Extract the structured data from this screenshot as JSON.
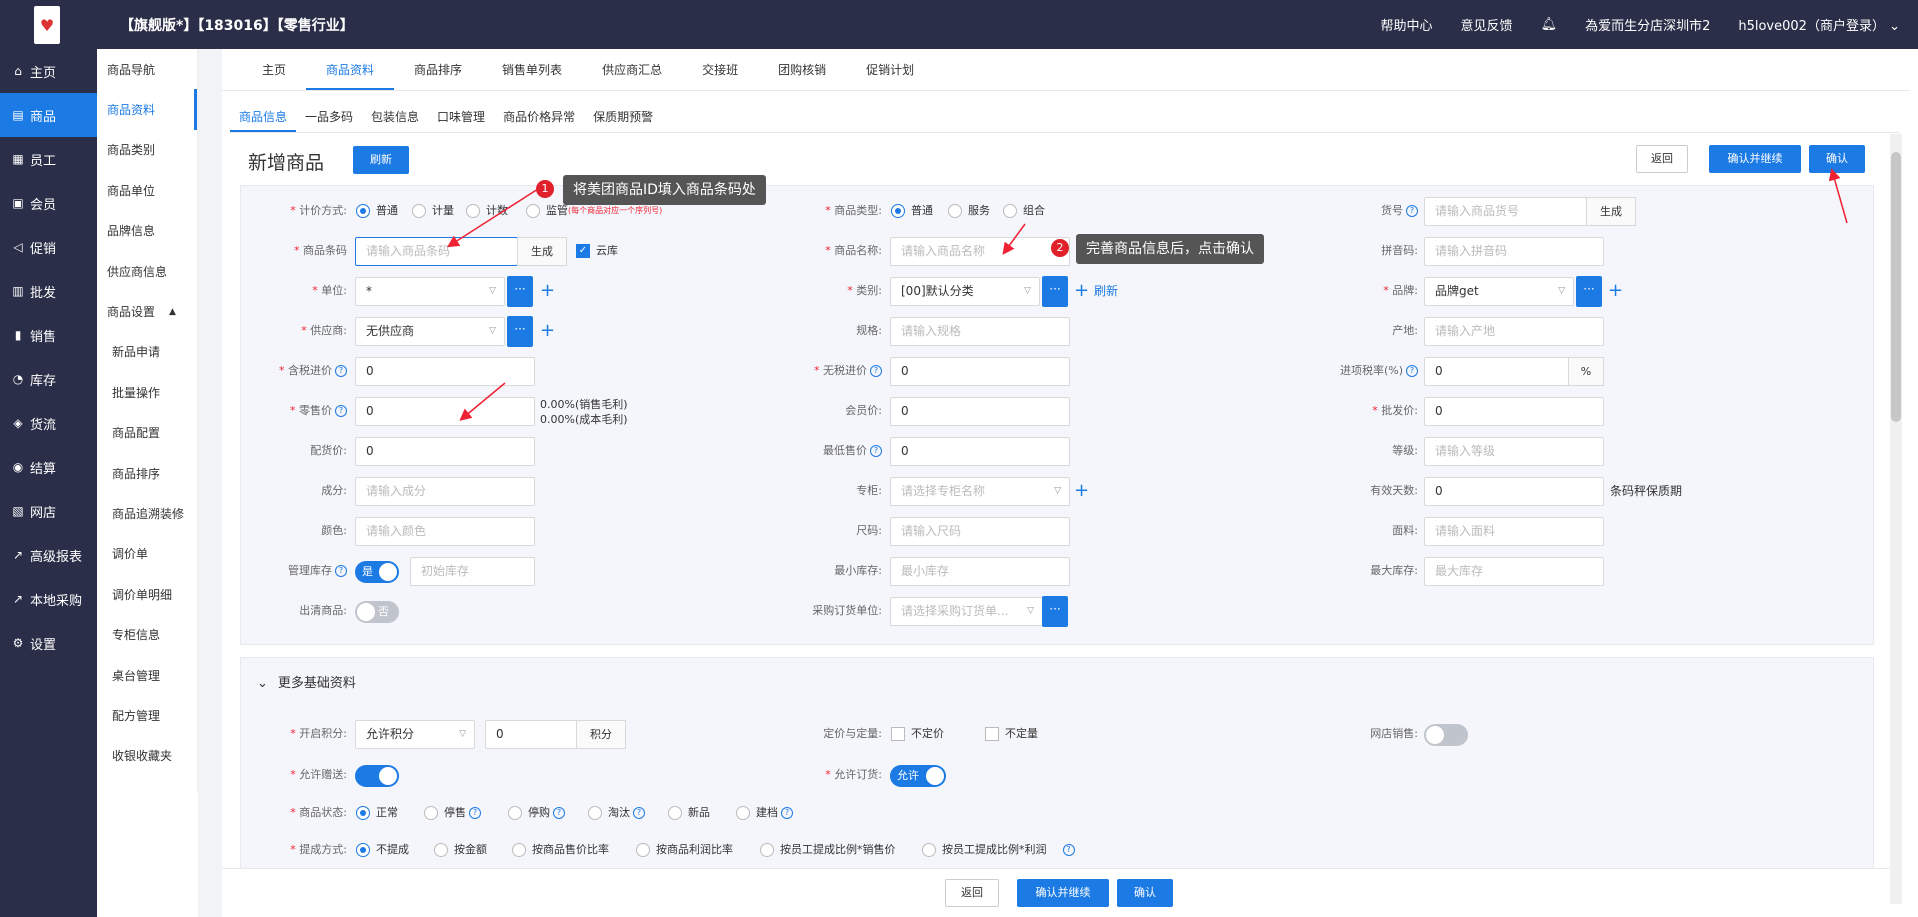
{
  "header": {
    "brand": "【旗舰版*】【183016】【零售行业】",
    "help": "帮助中心",
    "feedback": "意见反馈",
    "store": "為爱而生分店深圳市2",
    "user": "h5love002（商户登录）"
  },
  "sidebar": {
    "items": [
      {
        "label": "主页",
        "icon": "⌂"
      },
      {
        "label": "商品",
        "icon": "▤"
      },
      {
        "label": "员工",
        "icon": "▦"
      },
      {
        "label": "会员",
        "icon": "▣"
      },
      {
        "label": "促销",
        "icon": "◁"
      },
      {
        "label": "批发",
        "icon": "▥"
      },
      {
        "label": "销售",
        "icon": "▮"
      },
      {
        "label": "库存",
        "icon": "◔"
      },
      {
        "label": "货流",
        "icon": "◈"
      },
      {
        "label": "结算",
        "icon": "◉"
      },
      {
        "label": "网店",
        "icon": "▧"
      },
      {
        "label": "高级报表",
        "icon": "↗"
      },
      {
        "label": "本地采购",
        "icon": "↗"
      },
      {
        "label": "设置",
        "icon": "⚙"
      }
    ]
  },
  "subnav": {
    "items": [
      "商品导航",
      "商品资料",
      "商品类别",
      "商品单位",
      "品牌信息",
      "供应商信息",
      "商品设置",
      "新品申请",
      "批量操作",
      "商品配置",
      "商品排序",
      "商品追溯装修",
      "调价单",
      "调价单明细",
      "专柜信息",
      "桌台管理",
      "配方管理",
      "收银收藏夹"
    ]
  },
  "tabs": [
    "主页",
    "商品资料",
    "商品排序",
    "销售单列表",
    "供应商汇总",
    "交接班",
    "团购核销",
    "促销计划"
  ],
  "subtabs": [
    "商品信息",
    "一品多码",
    "包装信息",
    "口味管理",
    "商品价格异常",
    "保质期预警"
  ],
  "page": {
    "title": "新增商品",
    "refresh": "刷新",
    "back": "返回",
    "confirm_continue": "确认并继续",
    "confirm": "确认"
  },
  "form": {
    "pricing_method": {
      "label": "计价方式:",
      "options": [
        "普通",
        "计量",
        "计数",
        "监管"
      ],
      "note": "(每个商品对应一个序列号)"
    },
    "barcode": {
      "label": "商品条码",
      "placeholder": "请输入商品条码",
      "gen": "生成",
      "cloud": "云库"
    },
    "unit": {
      "label": "单位:",
      "value": "*"
    },
    "supplier": {
      "label": "供应商:",
      "value": "无供应商"
    },
    "tax_price": {
      "label": "含税进价",
      "value": "0"
    },
    "retail": {
      "label": "零售价",
      "value": "0",
      "note1": "0.00%(销售毛利)",
      "note2": "0.00%(成本毛利)"
    },
    "dist_price": {
      "label": "配货价:",
      "value": "0"
    },
    "composition": {
      "label": "成分:",
      "placeholder": "请输入成分"
    },
    "color": {
      "label": "颜色:",
      "placeholder": "请输入颜色"
    },
    "manage_stock": {
      "label": "管理库存",
      "toggle": "是",
      "placeholder": "初始库存"
    },
    "clearance": {
      "label": "出清商品:",
      "toggle": "否"
    },
    "goods_type": {
      "label": "商品类型:",
      "options": [
        "普通",
        "服务",
        "组合"
      ]
    },
    "name": {
      "label": "商品名称:",
      "placeholder": "请输入商品名称"
    },
    "category": {
      "label": "类别:",
      "value": "[00]默认分类",
      "refresh": "刷新"
    },
    "spec": {
      "label": "规格:",
      "placeholder": "请输入规格"
    },
    "notax_price": {
      "label": "无税进价",
      "value": "0"
    },
    "member_price": {
      "label": "会员价:",
      "value": "0"
    },
    "min_price": {
      "label": "最低售价",
      "value": "0"
    },
    "counter": {
      "label": "专柜:",
      "placeholder": "请选择专柜名称"
    },
    "size": {
      "label": "尺码:",
      "placeholder": "请输入尺码"
    },
    "min_stock": {
      "label": "最小库存:",
      "placeholder": "最小库存"
    },
    "purchase_unit": {
      "label": "采购订货单位:",
      "placeholder": "请选择采购订货单..."
    },
    "item_no": {
      "label": "货号",
      "placeholder": "请输入商品货号",
      "gen": "生成"
    },
    "pinyin": {
      "label": "拼音码:",
      "placeholder": "请输入拼音码"
    },
    "brand": {
      "label": "品牌:",
      "value": "品牌get"
    },
    "origin": {
      "label": "产地:",
      "placeholder": "请输入产地"
    },
    "input_tax": {
      "label": "进项税率(%)",
      "value": "0",
      "unit": "%"
    },
    "wholesale": {
      "label": "批发价:",
      "value": "0"
    },
    "grade": {
      "label": "等级:",
      "placeholder": "请输入等级"
    },
    "valid_days": {
      "label": "有效天数:",
      "value": "0",
      "note": "条码秤保质期"
    },
    "fabric": {
      "label": "面料:",
      "placeholder": "请输入面料"
    },
    "max_stock": {
      "label": "最大库存:",
      "placeholder": "最大库存"
    }
  },
  "more": {
    "title": "更多基础资料",
    "points": {
      "label": "开启积分:",
      "select": "允许积分",
      "value": "0",
      "unit": "积分"
    },
    "gift": {
      "label": "允许赠送:"
    },
    "status": {
      "label": "商品状态:",
      "options": [
        "正常",
        "停售",
        "停购",
        "淘汰",
        "新品",
        "建档"
      ]
    },
    "commission": {
      "label": "提成方式:",
      "options": [
        "不提成",
        "按金额",
        "按商品售价比率",
        "按商品利润比率",
        "按员工提成比例*销售价",
        "按员工提成比例*利润"
      ]
    },
    "fixed": {
      "label": "定价与定量:",
      "opt1": "不定价",
      "opt2": "不定量"
    },
    "order": {
      "label": "允许订货:",
      "toggle": "允许"
    },
    "online": {
      "label": "网店销售:"
    }
  },
  "tips": {
    "t1": "将美团商品ID填入商品条码处",
    "t2": "完善商品信息后，点击确认",
    "b1": "1",
    "b2": "2"
  }
}
